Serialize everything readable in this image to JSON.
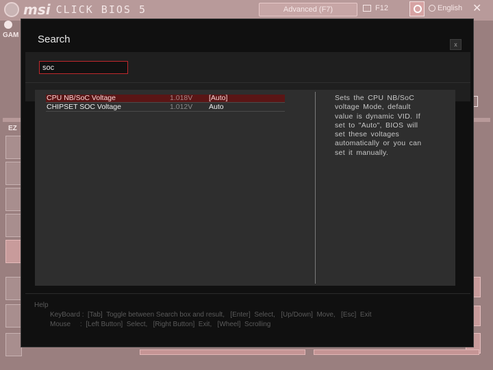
{
  "background": {
    "brand": "msi",
    "product": "CLICK BIOS 5",
    "mode_button": "Advanced (F7)",
    "f12_label": "F12",
    "language": "English",
    "close_glyph": "✕",
    "game_label": "GAM",
    "ez_label": "EZ"
  },
  "dialog": {
    "title": "Search",
    "close_label": "x",
    "search_value": "soc",
    "results": [
      {
        "name": "CPU NB/SoC Voltage",
        "voltage": "1.018V",
        "setting": "[Auto]",
        "selected": true
      },
      {
        "name": "CHIPSET SOC Voltage",
        "voltage": "1.012V",
        "setting": "Auto",
        "selected": false
      }
    ],
    "help_description": "Sets the CPU NB/SoC voltage Mode, default value is dynamic VID. If set to \"Auto\", BIOS will set these voltages automatically or you can set it manually.",
    "footer": {
      "help_label": "Help",
      "keyboard": "KeyBoard :  [Tab]  Toggle between Search box and result,   [Enter]  Select,   [Up/Down]  Move,   [Esc]  Exit",
      "mouse": "Mouse     :  [Left Button]  Select,   [Right Button]  Exit,   [Wheel]  Scrolling"
    }
  },
  "colors": {
    "accent": "#c0282c",
    "selected_row": "#5a1515",
    "overlay_tint": "#9a7f7f"
  },
  "icons": {
    "logo": "msi-dragon-icon",
    "search": "search-icon",
    "language": "globe-icon",
    "clock": "clock-icon",
    "close": "close-icon",
    "f12": "screenshot-icon"
  }
}
